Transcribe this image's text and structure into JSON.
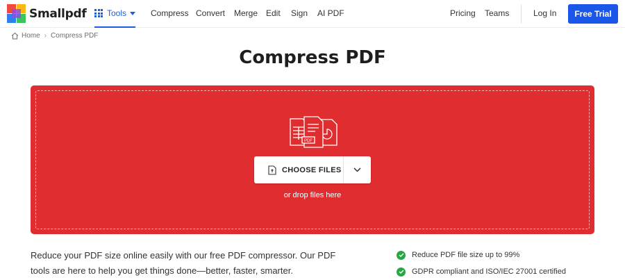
{
  "brand": {
    "name": "Smallpdf"
  },
  "nav": {
    "tools_label": "Tools",
    "links": [
      "Compress",
      "Convert",
      "Merge",
      "Edit",
      "Sign",
      "AI PDF"
    ],
    "pricing": "Pricing",
    "teams": "Teams",
    "login": "Log In",
    "trial": "Free Trial"
  },
  "breadcrumb": {
    "home": "Home",
    "current": "Compress PDF"
  },
  "page": {
    "title": "Compress PDF"
  },
  "dropzone": {
    "choose_label": "CHOOSE FILES",
    "hint": "or drop files here",
    "background": "#e02d2f"
  },
  "description": "Reduce your PDF size online easily with our free PDF compressor. Our PDF tools are here to help you get things done—better, faster, smarter.",
  "features": [
    "Reduce PDF file size up to 99%",
    "GDPR compliant and ISO/IEC 27001 certified"
  ],
  "colors": {
    "accent": "#1a56e8",
    "tools": "#1e5dd8",
    "check": "#28a745"
  }
}
